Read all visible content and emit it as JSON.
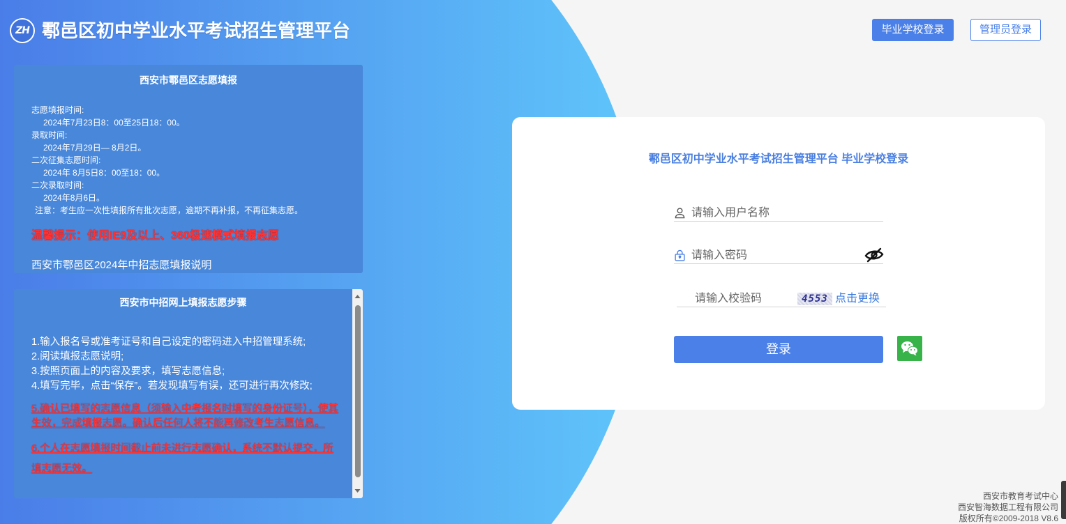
{
  "header": {
    "logo_text": "ZH",
    "title": "鄠邑区初中学业水平考试招生管理平台",
    "school_login_label": "毕业学校登录",
    "admin_login_label": "管理员登录"
  },
  "notice_panel": {
    "title": "西安市鄠邑区志愿填报",
    "schedule": [
      {
        "label": "志愿填报时间:",
        "value": "2024年7月23日8：00至25日18：00。"
      },
      {
        "label": "录取时间:",
        "value": "2024年7月29日— 8月2日。"
      },
      {
        "label": "二次征集志愿时间:",
        "value": "2024年 8月5日8：00至18：00。"
      },
      {
        "label": "二次录取时间:",
        "value": "2024年8月6日。"
      }
    ],
    "note": "注意：考生应一次性填报所有批次志愿，逾期不再补报，不再征集志愿。",
    "tip": "温馨提示：使用IE9及以上、360极速模式填报志愿",
    "guide_link": "西安市鄠邑区2024年中招志愿填报说明"
  },
  "steps_panel": {
    "title": "西安市中招网上填报志愿步骤",
    "steps": [
      "1.输入报名号或准考证号和自己设定的密码进入中招管理系统;",
      "2.阅读填报志愿说明;",
      "3.按照页面上的内容及要求，填写志愿信息;",
      "4.填写完毕，点击“保存”。若发现填写有误，还可进行再次修改;"
    ],
    "warnings": [
      "5.确认已填写的志愿信息（须输入中考报名时填写的身份证号），使其生效，完成填报志愿。确认后任何人将不能再修改考生志愿信息。",
      "6.个人在志愿填报时间截止前未进行志愿确认，系统不默认提交，所填志愿无效。"
    ]
  },
  "login": {
    "title": "鄠邑区初中学业水平考试招生管理平台 毕业学校登录",
    "username_placeholder": "请输入用户名称",
    "password_placeholder": "请输入密码",
    "captcha_placeholder": "请输入校验码",
    "captcha_code": "4553",
    "captcha_refresh": "点击更换",
    "submit_label": "登录"
  },
  "footer": {
    "lines": [
      "西安市教育考试中心",
      "西安智海数据工程有限公司",
      "版权所有©2009-2018 V8.6"
    ]
  },
  "icons": {
    "logo": "zh-logo",
    "username": "user-icon",
    "password": "lock-icon",
    "toggle_password": "eye-slash-icon",
    "wechat_login": "wechat-icon",
    "scroll_up": "scroll-up-arrow-icon",
    "scroll_down": "scroll-down-arrow-icon"
  },
  "colors": {
    "primary_blue": "#4a80e8",
    "gradient_start": "#4a7de8",
    "gradient_end": "#5fc4fa",
    "panel_blue": "#4887da",
    "warning_red": "#ff3333",
    "wechat_green": "#37b34a",
    "page_background": "#f5f5f5"
  }
}
